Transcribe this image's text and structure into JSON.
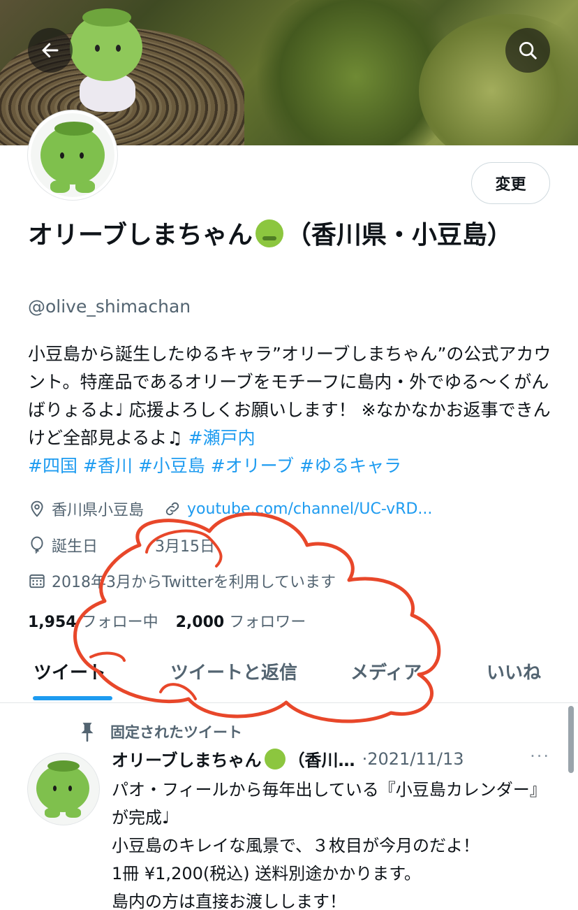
{
  "header": {
    "back_icon": "arrow-left-icon",
    "search_icon": "search-icon"
  },
  "profile": {
    "edit_label": "変更",
    "display_name_part1": "オリーブしまちゃん",
    "display_name_emoji": "nauseated-face-emoji",
    "display_name_part2": "（香川県・小豆島）",
    "handle": "@olive_shimachan",
    "bio_text": "小豆島から誕生したゆるキャラ”オリーブしまちゃん”の公式アカウント。特産品であるオリーブをモチーフに島内・外でゆる〜くがんばりょるよ♩ 応援よろしくお願いします！ ※なかなかお返事できんけど全部見よるよ♫ ",
    "bio_hashtags": [
      "#瀬戸内",
      "#四国",
      "#香川",
      "#小豆島",
      "#オリーブ",
      "#ゆるキャラ"
    ],
    "location": "香川県小豆島",
    "url": "youtube.com/channel/UC-vRD...",
    "birthday_label": "誕生日",
    "birthday_value": "3月15日",
    "joined": "2018年3月からTwitterを利用しています",
    "following_count": "1,954",
    "following_label": "フォロー中",
    "followers_count": "2,000",
    "followers_label": "フォロワー"
  },
  "tabs": [
    "ツイート",
    "ツイートと返信",
    "メディア",
    "いいね"
  ],
  "pinned_tweet": {
    "pinned_label": "固定されたツイート",
    "author_name": "オリーブしまちゃん",
    "author_suffix": "（香川…",
    "date": "·2021/11/13",
    "more": "···",
    "text": "パオ・フィールから毎年出している『小豆島カレンダー』が完成♩\n小豆島のキレイな風景で、３枚目が今月のだよ！\n1冊 ¥1,200(税込) 送料別途かかります。\n島内の方は直接お渡しします！"
  },
  "colors": {
    "accent": "#1d9bf0",
    "secondary_text": "#536471",
    "scribble": "#e8472a"
  }
}
